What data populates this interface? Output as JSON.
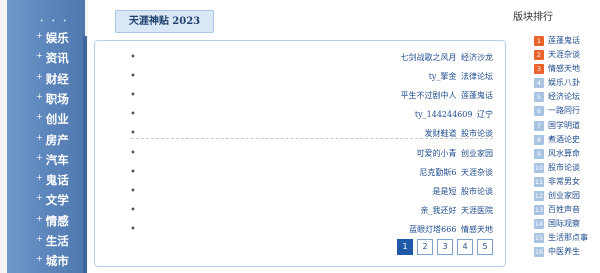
{
  "nav": {
    "top_dots": "• • •",
    "items": [
      "娱乐",
      "资讯",
      "财经",
      "职场",
      "创业",
      "房产",
      "汽车",
      "鬼话",
      "文学",
      "情感",
      "生活",
      "城市"
    ]
  },
  "center": {
    "title": "天涯神贴 2023",
    "bullet": "•",
    "group1": [
      {
        "title": "七剑战歌之风月",
        "board": "经济沙龙"
      },
      {
        "title": "ty_擎金",
        "board": "法律论坛"
      },
      {
        "title": "平生不过剧中人",
        "board": "莲蓬鬼话"
      },
      {
        "title": "ty_144244609",
        "board": "辽宁"
      },
      {
        "title": "发财鞋道",
        "board": "股市论谈"
      }
    ],
    "group2": [
      {
        "title": "可爱的小青",
        "board": "创业家园"
      },
      {
        "title": "尼克勤斯6",
        "board": "天涯杂谈"
      },
      {
        "title": "是是短",
        "board": "股市论谈"
      },
      {
        "title": "亲_我还好",
        "board": "天涯医院"
      },
      {
        "title": "蓝眼灯塔666",
        "board": "情感天地"
      }
    ],
    "pages": [
      "1",
      "2",
      "3",
      "4",
      "5"
    ],
    "active_page": "1"
  },
  "rank": {
    "title": "版块排行",
    "hot_color": "#e8632c",
    "items": [
      {
        "num": "1",
        "label": "莲蓬鬼话"
      },
      {
        "num": "2",
        "label": "天涯杂谈"
      },
      {
        "num": "3",
        "label": "情感天地"
      },
      {
        "num": "4",
        "label": "娱乐八卦"
      },
      {
        "num": "5",
        "label": "经济论坛"
      },
      {
        "num": "6",
        "label": "一路同行"
      },
      {
        "num": "7",
        "label": "国学明道"
      },
      {
        "num": "8",
        "label": "煮酒论史"
      },
      {
        "num": "9",
        "label": "风水算命"
      },
      {
        "num": "10",
        "label": "股市论谈"
      },
      {
        "num": "11",
        "label": "非常男女"
      },
      {
        "num": "12",
        "label": "创业家园"
      },
      {
        "num": "13",
        "label": "百姓声音"
      },
      {
        "num": "14",
        "label": "国际观察"
      },
      {
        "num": "15",
        "label": "生活那点事"
      },
      {
        "num": "16",
        "label": "中医养生"
      }
    ]
  }
}
